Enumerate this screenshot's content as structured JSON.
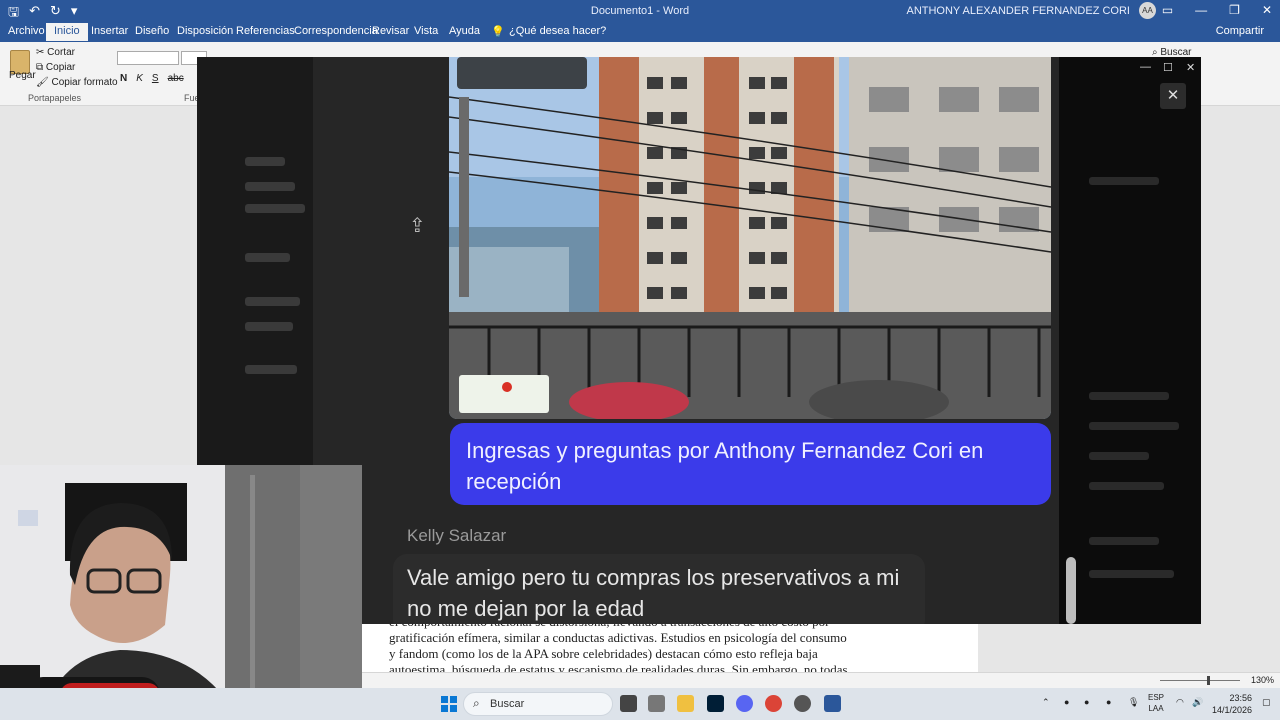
{
  "titlebar": {
    "document": "Documento1 - Word",
    "user": "ANTHONY ALEXANDER FERNANDEZ CORI",
    "avatar_initials": "AA"
  },
  "tabs": [
    "Archivo",
    "Inicio",
    "Insertar",
    "Diseño",
    "Disposición",
    "Referencias",
    "Correspondencia",
    "Revisar",
    "Vista",
    "Ayuda"
  ],
  "tell_me": "¿Qué desea hacer?",
  "share": "Compartir",
  "ribbon": {
    "paste": "Pegar",
    "cut": "Cortar",
    "copy": "Copiar",
    "format_painter": "Copiar formato",
    "clipboard_group": "Portapapeles",
    "font_group": "Fue",
    "bold": "N",
    "italic": "K",
    "underline": "S",
    "strike": "abc",
    "search": "Buscar"
  },
  "viewer": {
    "message_blue": "Ingresas y preguntas por Anthony Fernandez Cori en recepción",
    "sender": "Kelly Salazar",
    "message_gray": "Vale amigo pero tu compras los preservativos a mi no me dejan por la edad",
    "close_symbol": "✕"
  },
  "document": {
    "lines": [
      "el comportamiento racional se distorsiona, llevando a transacciones de alto costo por",
      "gratificación efímera, similar a conductas adictivas. Estudios en psicología del consumo",
      "y fandom (como los de la APA sobre celebridades) destacan cómo esto refleja baja",
      "autoestima, búsqueda de estatus y escapismo de realidades duras. Sin embargo, no todas"
    ]
  },
  "statusbar": {
    "zoom": "130%"
  },
  "taskbar": {
    "search": "Buscar",
    "lang_top": "ESP",
    "lang_bottom": "LAA",
    "time": "23:56",
    "date": "14/1/2026"
  }
}
